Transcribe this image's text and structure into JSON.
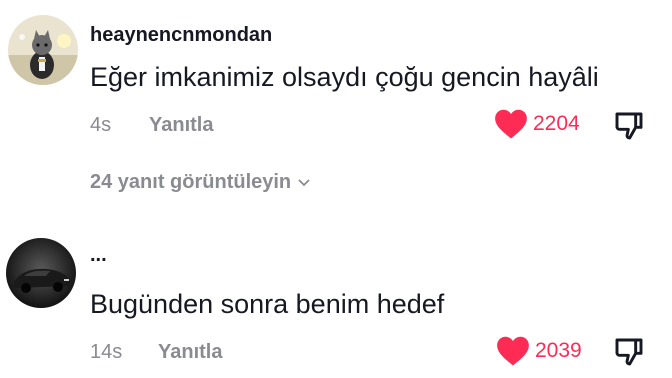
{
  "comments": [
    {
      "username": "heaynencnmondan",
      "text": "Eğer imkanimiz olsaydı çoğu gencin hayâli",
      "time": "4s",
      "reply_label": "Yanıtla",
      "like_count": "2204",
      "liked": true,
      "avatar_icon": "cat-avatar",
      "view_replies_label": "24 yanıt görüntüleyin"
    },
    {
      "username": "...",
      "text": "Bugünden sonra benim hedef",
      "time": "14s",
      "reply_label": "Yanıtla",
      "like_count": "2039",
      "liked": true,
      "avatar_icon": "dark-car-avatar"
    }
  ],
  "colors": {
    "like_red": "#fe2c55",
    "muted_gray": "#8a8b91",
    "text_dark": "#161823"
  }
}
